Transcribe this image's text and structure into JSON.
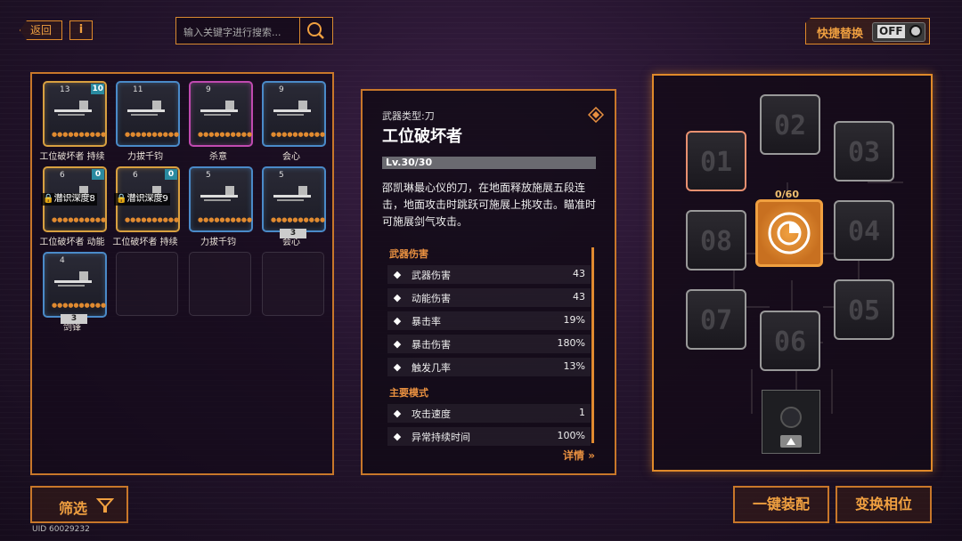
{
  "header": {
    "back_label": "返回",
    "info_label": "i",
    "search_placeholder": "输入关键字进行搜索...",
    "quick_replace_label": "快捷替换",
    "toggle_label": "OFF"
  },
  "inventory": {
    "items": [
      {
        "name": "工位破坏者 持续",
        "level": "13",
        "badge": "10",
        "rarity": "gold",
        "lock_text": "",
        "count": ""
      },
      {
        "name": "力拔千钧",
        "level": "11",
        "badge": "",
        "rarity": "blue",
        "lock_text": "",
        "count": ""
      },
      {
        "name": "杀意",
        "level": "9",
        "badge": "",
        "rarity": "purple",
        "lock_text": "",
        "count": ""
      },
      {
        "name": "会心",
        "level": "9",
        "badge": "",
        "rarity": "blue",
        "lock_text": "",
        "count": ""
      },
      {
        "name": "工位破坏者 动能",
        "level": "6",
        "badge": "0",
        "rarity": "gold",
        "lock_text": "潜识深度8",
        "count": ""
      },
      {
        "name": "工位破坏者 持续",
        "level": "6",
        "badge": "0",
        "rarity": "gold",
        "lock_text": "潜识深度9",
        "count": ""
      },
      {
        "name": "力拔千钧",
        "level": "5",
        "badge": "",
        "rarity": "blue",
        "lock_text": "",
        "count": ""
      },
      {
        "name": "会心",
        "level": "5",
        "badge": "",
        "rarity": "blue",
        "lock_text": "",
        "count": "3"
      },
      {
        "name": "剑锋",
        "level": "4",
        "badge": "",
        "rarity": "blue",
        "lock_text": "",
        "count": "3"
      }
    ]
  },
  "detail": {
    "type_label": "武器类型:刀",
    "weapon_name": "工位破坏者",
    "level_text": "Lv.30/30",
    "level_fraction": 1.0,
    "description": "邵凯琳最心仪的刀，在地面释放施展五段连击，地面攻击时跳跃可施展上挑攻击。瞄准时可施展剑气攻击。",
    "section_damage": "武器伤害",
    "section_mode": "主要模式",
    "stats": [
      {
        "name": "武器伤害",
        "value": "43",
        "icon": "sword-icon"
      },
      {
        "name": "动能伤害",
        "value": "43",
        "icon": "kinetic-icon"
      },
      {
        "name": "暴击率",
        "value": "19%",
        "icon": "crit-rate-icon"
      },
      {
        "name": "暴击伤害",
        "value": "180%",
        "icon": "crit-damage-icon"
      },
      {
        "name": "触发几率",
        "value": "13%",
        "icon": "lightning-icon"
      }
    ],
    "mode_stats": [
      {
        "name": "攻击速度",
        "value": "1",
        "icon": "speed-icon"
      },
      {
        "name": "异常持续时间",
        "value": "100%",
        "icon": "duration-icon"
      }
    ],
    "details_link": "详情"
  },
  "slots": {
    "labels": [
      "01",
      "02",
      "03",
      "04",
      "05",
      "06",
      "07",
      "08"
    ],
    "core_capacity": "0/60"
  },
  "footer": {
    "filter_label": "筛选",
    "uid_text": "UID 60029232",
    "equip_label": "一键装配",
    "swap_label": "变换相位"
  },
  "colors": {
    "accent": "#e08a2a",
    "gold": "#d8a040",
    "blue": "#4a8ac8",
    "purple": "#c04ab0"
  }
}
